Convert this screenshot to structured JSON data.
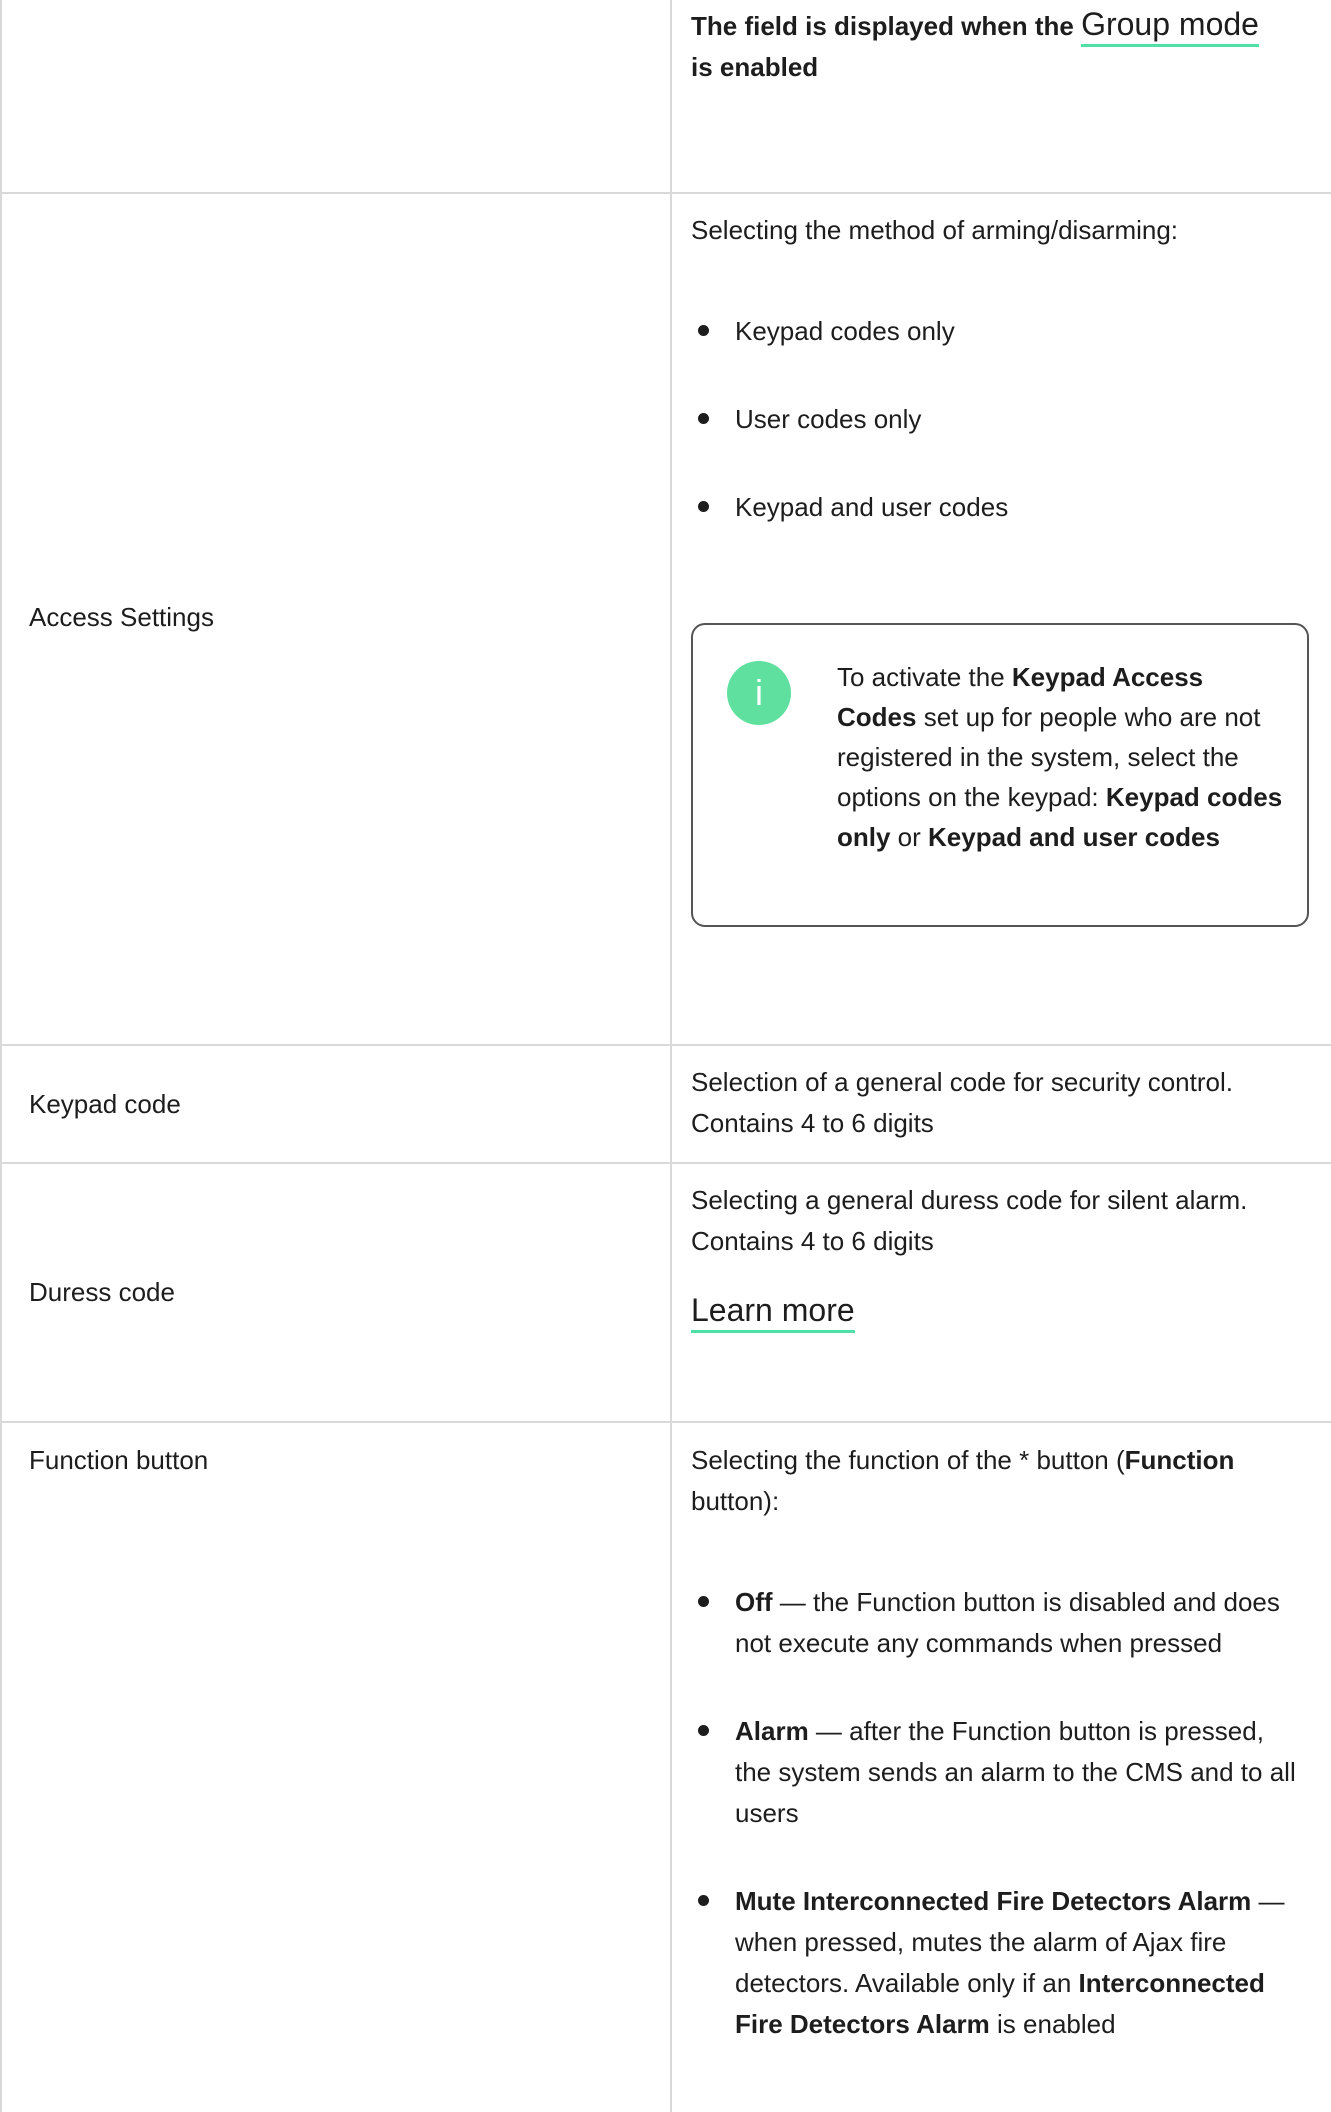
{
  "row_group_mode": {
    "desc_prefix": "The field is displayed when the ",
    "link": "Group mode",
    "desc_suffix": "is enabled"
  },
  "row_access": {
    "label": "Access Settings",
    "intro": "Selecting the method of arming/disarming:",
    "options": [
      "Keypad codes only",
      "User codes only",
      "Keypad and user codes"
    ],
    "note": {
      "icon": "info-icon",
      "t1": "To activate the ",
      "b1": "Keypad Access Codes",
      "t2": " set up for people who are not registered in the system, select the options on the keypad: ",
      "b2": "Keypad codes only",
      "t3": " or ",
      "b3": "Keypad and user codes"
    }
  },
  "row_keypad_code": {
    "label": "Keypad code",
    "desc": "Selection of a general code for security control. Contains 4 to 6 digits"
  },
  "row_duress": {
    "label": "Duress code",
    "desc": "Selecting a general duress code for silent alarm. Contains 4 to 6 digits",
    "link": "Learn more"
  },
  "row_function": {
    "label": "Function button",
    "intro_t1": "Selecting the function of the * button (",
    "intro_b": "Function",
    "intro_t2": " button):",
    "items": [
      {
        "b": "Off",
        "t": " — the Function button is disabled and does not execute any commands when pressed"
      },
      {
        "b": "Alarm",
        "t": " — after the Function button is pressed, the system sends an alarm to the CMS and to all users"
      },
      {
        "b": "Mute Interconnected Fire Detectors Alarm",
        "t": " — when pressed, mutes the alarm of Ajax fire detectors. Available only if an ",
        "b2": "Interconnected Fire Detectors Alarm",
        "t2": " is enabled"
      }
    ]
  }
}
